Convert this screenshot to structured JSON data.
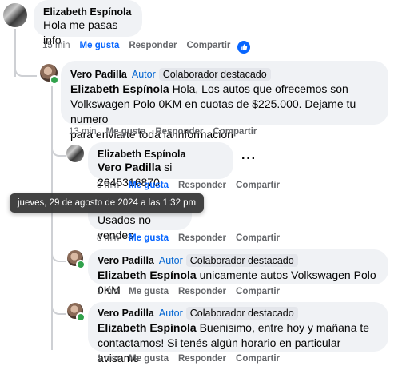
{
  "comments": [
    {
      "author": "Elizabeth Espínola",
      "text": "Hola me pasas info",
      "time": "15 min",
      "like": "Me gusta",
      "reply": "Responder",
      "share": "Compartir"
    },
    {
      "author": "Vero Padilla",
      "author_tag": "Autor",
      "badge": "Colaborador destacado",
      "mention": "Elizabeth Espínola",
      "text_line1": " Hola, Los autos que ofrecemos son",
      "text_line2": "Volkswagen Polo 0KM en cuotas de $225.000. Dejame tu numero",
      "text_line3": "para enviarte toda la informacion",
      "time": "13 min",
      "like": "Me gusta",
      "reply": "Responder",
      "share": "Compartir"
    },
    {
      "author": "Elizabeth Espínola",
      "mention": "Vero Padilla",
      "text": " si 2645316870",
      "time": "8 min",
      "like": "Me gusta",
      "reply": "Responder",
      "share": "Compartir",
      "more": "···"
    },
    {
      "text": "Usados no vendes",
      "time": "8 min",
      "like": "Me gusta",
      "reply": "Responder",
      "share": "Compartir"
    },
    {
      "author": "Vero Padilla",
      "author_tag": "Autor",
      "badge": "Colaborador destacado",
      "mention": "Elizabeth Espínola",
      "text": " unicamente autos Volkswagen Polo 0KM",
      "time": "1 min",
      "like": "Me gusta",
      "reply": "Responder",
      "share": "Compartir"
    },
    {
      "author": "Vero Padilla",
      "author_tag": "Autor",
      "badge": "Colaborador destacado",
      "mention": "Elizabeth Espínola",
      "text_line1": " Buenisimo, entre hoy y mañana te",
      "text_line2": "contactamos! Si tenés algún horario en particular avisame",
      "time": "1 min",
      "like": "Me gusta",
      "reply": "Responder",
      "share": "Compartir"
    }
  ],
  "tooltip": "jueves, 29 de agosto de 2024 a las 1:32 pm",
  "colors": {
    "accent": "#0866ff",
    "bubble": "#f0f2f5",
    "online": "#31a24c"
  }
}
